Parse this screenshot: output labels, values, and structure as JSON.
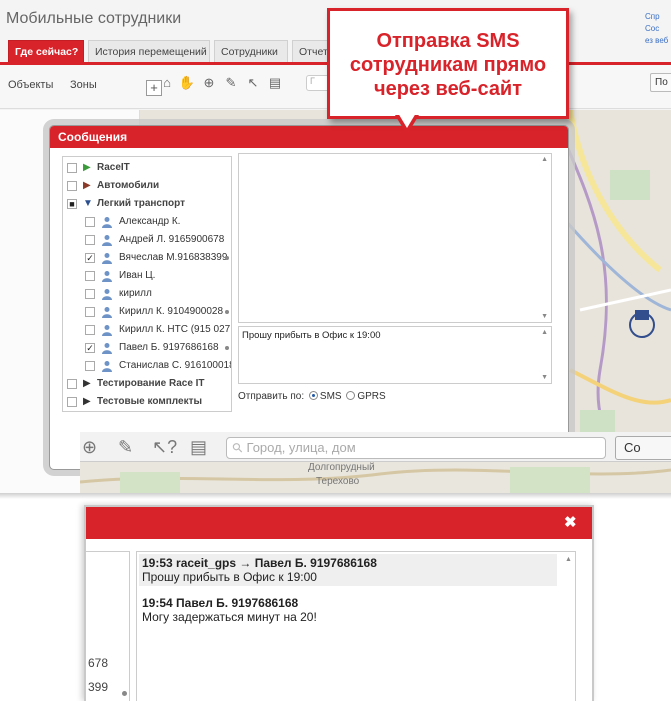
{
  "app": {
    "title": "Мобильные сотрудники",
    "top_links": [
      "Спр",
      "Сос",
      "ез веб"
    ],
    "tabs": [
      {
        "label": "Где сейчас?",
        "active": true
      },
      {
        "label": "История перемещений",
        "active": false
      },
      {
        "label": "Сотрудники",
        "active": false
      },
      {
        "label": "Отчеты",
        "active": false
      }
    ],
    "subbar": {
      "objects": "Объекты",
      "zones": "Зоны",
      "search_placeholder": "Г",
      "right_button": "По"
    },
    "accent_color": "#d9232a"
  },
  "callout": {
    "text": "Отправка SMS\nсотрудникам прямо\nчерез веб-сайт"
  },
  "messages_dialog": {
    "title": "Сообщения",
    "tree": [
      {
        "label": "RaceIT",
        "level": 0,
        "kind": "group",
        "icon": "play-green-icon",
        "checked": false
      },
      {
        "label": "Автомобили",
        "level": 0,
        "kind": "group",
        "icon": "play-brown-icon",
        "checked": false
      },
      {
        "label": "Легкий транспорт",
        "level": 0,
        "kind": "group-open",
        "icon": "triangle-down-icon",
        "checked": "partial"
      },
      {
        "label": "Александр К.",
        "level": 1,
        "kind": "person",
        "checked": false,
        "online": false
      },
      {
        "label": "Андрей Л. 9165900678",
        "level": 1,
        "kind": "person",
        "checked": false,
        "online": false
      },
      {
        "label": "Вячеслав М.916838399",
        "level": 1,
        "kind": "person",
        "checked": true,
        "online": true
      },
      {
        "label": "Иван Ц.",
        "level": 1,
        "kind": "person",
        "checked": false,
        "online": false
      },
      {
        "label": "кирилл",
        "level": 1,
        "kind": "person",
        "checked": false,
        "online": false
      },
      {
        "label": "Кирилл К. 9104900028",
        "level": 1,
        "kind": "person",
        "checked": false,
        "online": true
      },
      {
        "label": "Кирилл К. HTC (915 027",
        "level": 1,
        "kind": "person",
        "checked": false,
        "online": false
      },
      {
        "label": "Павел Б. 9197686168",
        "level": 1,
        "kind": "person",
        "checked": true,
        "online": true
      },
      {
        "label": "Станислав С. 916100018",
        "level": 1,
        "kind": "person",
        "checked": false,
        "online": false
      },
      {
        "label": "Тестирование Race IT",
        "level": 0,
        "kind": "group",
        "icon": "play-dark-icon",
        "checked": false
      },
      {
        "label": "Тестовые комплекты",
        "level": 0,
        "kind": "group",
        "icon": "play-dark-icon",
        "checked": false
      }
    ],
    "input_text": "Прошу прибыть в Офис к 19:00",
    "send_by_label": "Отправить по:",
    "send_options": [
      {
        "label": "SMS",
        "selected": true
      },
      {
        "label": "GPRS",
        "selected": false
      }
    ]
  },
  "zoom_toolbar": {
    "search_placeholder": "Город, улица, дом",
    "button_label": "Со",
    "map_labels": [
      "Долгопрудный",
      "Терехово"
    ]
  },
  "chat": {
    "left_fragments": [
      "678",
      "399"
    ],
    "messages": [
      {
        "header": "19:53  raceit_gps → Павел Б. 9197686168",
        "body": "Прошу прибыть в Офис к 19:00"
      },
      {
        "header": "19:54  Павел Б. 9197686168",
        "body": "Могу задержаться минут на 20!"
      }
    ]
  }
}
